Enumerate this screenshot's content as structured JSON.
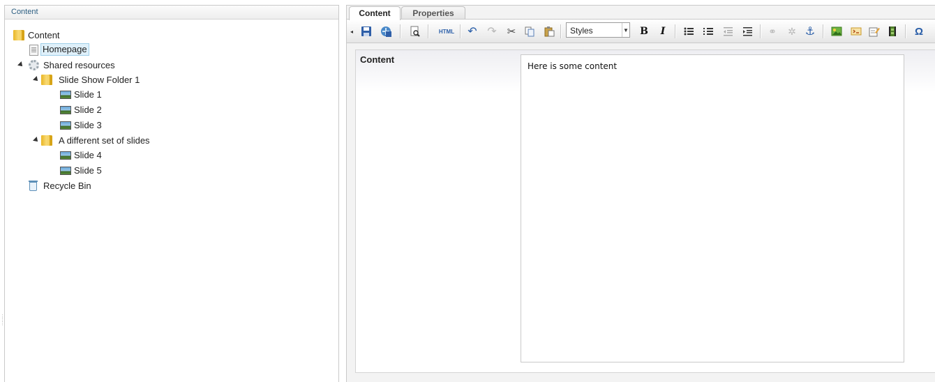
{
  "left_panel": {
    "header": "Content",
    "tree": [
      {
        "label": "Content",
        "icon": "folder-icon"
      },
      {
        "label": "Homepage",
        "icon": "page-icon",
        "selected": true
      },
      {
        "label": "Shared resources",
        "icon": "gear-icon",
        "expanded": true
      },
      {
        "label": "Slide Show Folder 1",
        "icon": "folder-icon",
        "expanded": true
      },
      {
        "label": "Slide 1",
        "icon": "image-icon"
      },
      {
        "label": "Slide 2",
        "icon": "image-icon"
      },
      {
        "label": "Slide 3",
        "icon": "image-icon"
      },
      {
        "label": "A different set of slides",
        "icon": "folder-icon",
        "expanded": true
      },
      {
        "label": "Slide 4",
        "icon": "image-icon"
      },
      {
        "label": "Slide 5",
        "icon": "image-icon"
      },
      {
        "label": "Recycle Bin",
        "icon": "recycle-bin-icon"
      }
    ]
  },
  "tabs": [
    {
      "label": "Content",
      "active": true
    },
    {
      "label": "Properties",
      "active": false
    }
  ],
  "toolbar": {
    "styles_value": "Styles",
    "html_label": "HTML",
    "bold_label": "B",
    "italic_label": "I",
    "omega_label": "Ω"
  },
  "editor": {
    "property_label": "Content",
    "body_text": "Here is some content"
  }
}
